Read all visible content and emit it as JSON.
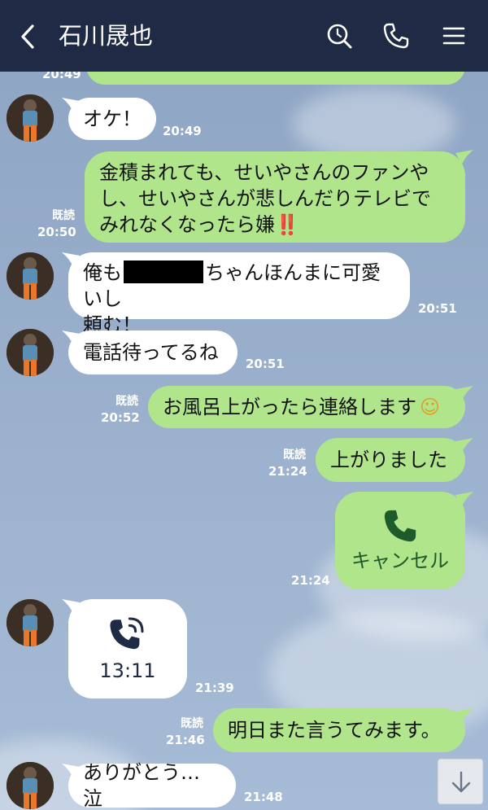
{
  "header": {
    "title": "石川晟也"
  },
  "icons": {
    "back": "chevron-left-icon",
    "search": "search-icon",
    "call": "phone-icon",
    "menu": "menu-icon",
    "scroll": "arrow-down-icon"
  },
  "colors": {
    "header_bg": "#1f2a44",
    "my_bubble": "#b0e58c",
    "their_bubble": "#ffffff"
  },
  "partial_top": {
    "time": "20:49"
  },
  "messages": [
    {
      "from": "them",
      "text": "オケ！",
      "time": "20:49"
    },
    {
      "from": "me",
      "lines": [
        "金積まれても、せいやさんのファンや",
        "し、せいやさんが悲しんだりテレビで",
        "みれなくなったら嫌‼️"
      ],
      "read": "既読",
      "time": "20:50"
    },
    {
      "from": "them",
      "line1_pre": "俺も",
      "line1_post": "ちゃんほんまに可愛いし",
      "line2": "頼む！",
      "time": "20:51"
    },
    {
      "from": "them",
      "text": "電話待ってるね",
      "time": "20:51"
    },
    {
      "from": "me",
      "text": "お風呂上がったら連絡します",
      "emoji": "☺",
      "read": "既読",
      "time": "20:52"
    },
    {
      "from": "me",
      "text": "上がりました",
      "read": "既読",
      "time": "21:24"
    },
    {
      "from": "me",
      "type": "call",
      "label": "キャンセル",
      "time": "21:24"
    },
    {
      "from": "them",
      "type": "call",
      "label": "13:11",
      "time": "21:39"
    },
    {
      "from": "me",
      "text": "明日また言うてみます。",
      "read": "既読",
      "time": "21:46"
    },
    {
      "from": "them",
      "text": "ありがとう… 泣",
      "time": "21:48"
    }
  ]
}
